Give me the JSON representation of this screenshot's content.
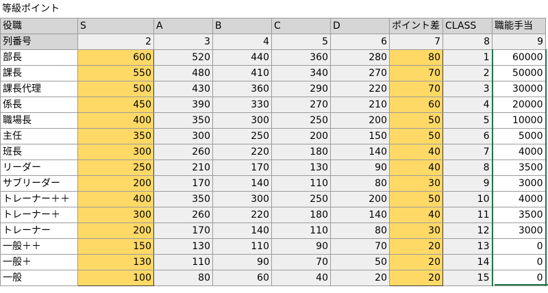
{
  "title": "等級ポイント",
  "header": [
    "役職",
    "S",
    "A",
    "B",
    "C",
    "D",
    "ポイント差",
    "CLASS",
    "職能手当"
  ],
  "colno": {
    "label": "列番号",
    "values": [
      "2",
      "3",
      "4",
      "5",
      "6",
      "7",
      "8",
      "9"
    ]
  },
  "rows": [
    {
      "role": "部長",
      "values": [
        "600",
        "520",
        "440",
        "360",
        "280",
        "80",
        "1",
        "60000"
      ]
    },
    {
      "role": "課長",
      "values": [
        "550",
        "480",
        "410",
        "340",
        "270",
        "70",
        "2",
        "50000"
      ]
    },
    {
      "role": "課長代理",
      "values": [
        "500",
        "430",
        "360",
        "290",
        "220",
        "70",
        "3",
        "30000"
      ]
    },
    {
      "role": "係長",
      "values": [
        "450",
        "390",
        "330",
        "270",
        "210",
        "60",
        "4",
        "20000"
      ]
    },
    {
      "role": "職場長",
      "values": [
        "400",
        "350",
        "300",
        "250",
        "200",
        "50",
        "5",
        "10000"
      ]
    },
    {
      "role": "主任",
      "values": [
        "350",
        "300",
        "250",
        "200",
        "150",
        "50",
        "6",
        "5000"
      ]
    },
    {
      "role": "班長",
      "values": [
        "300",
        "260",
        "220",
        "180",
        "140",
        "40",
        "7",
        "4000"
      ]
    },
    {
      "role": "リーダー",
      "values": [
        "250",
        "210",
        "170",
        "130",
        "90",
        "40",
        "8",
        "3500"
      ]
    },
    {
      "role": "サブリーダー",
      "values": [
        "200",
        "170",
        "140",
        "110",
        "80",
        "30",
        "9",
        "3000"
      ]
    },
    {
      "role": "トレーナー＋＋",
      "values": [
        "400",
        "350",
        "300",
        "250",
        "200",
        "50",
        "10",
        "4000"
      ]
    },
    {
      "role": "トレーナー＋",
      "values": [
        "300",
        "260",
        "220",
        "180",
        "140",
        "40",
        "11",
        "3500"
      ]
    },
    {
      "role": "トレーナー",
      "values": [
        "200",
        "170",
        "140",
        "110",
        "80",
        "30",
        "12",
        "3000"
      ]
    },
    {
      "role": "一般＋＋",
      "values": [
        "150",
        "130",
        "110",
        "90",
        "70",
        "20",
        "13",
        "0"
      ]
    },
    {
      "role": "一般＋",
      "values": [
        "130",
        "110",
        "90",
        "70",
        "50",
        "20",
        "14",
        "0"
      ]
    },
    {
      "role": "一般",
      "values": [
        "100",
        "80",
        "60",
        "40",
        "20",
        "20",
        "15",
        "0"
      ]
    }
  ],
  "colors": {
    "highlight": "#ffd966",
    "header": "#d6d6d6",
    "shaded": "#efefef",
    "selection": "#217346"
  }
}
